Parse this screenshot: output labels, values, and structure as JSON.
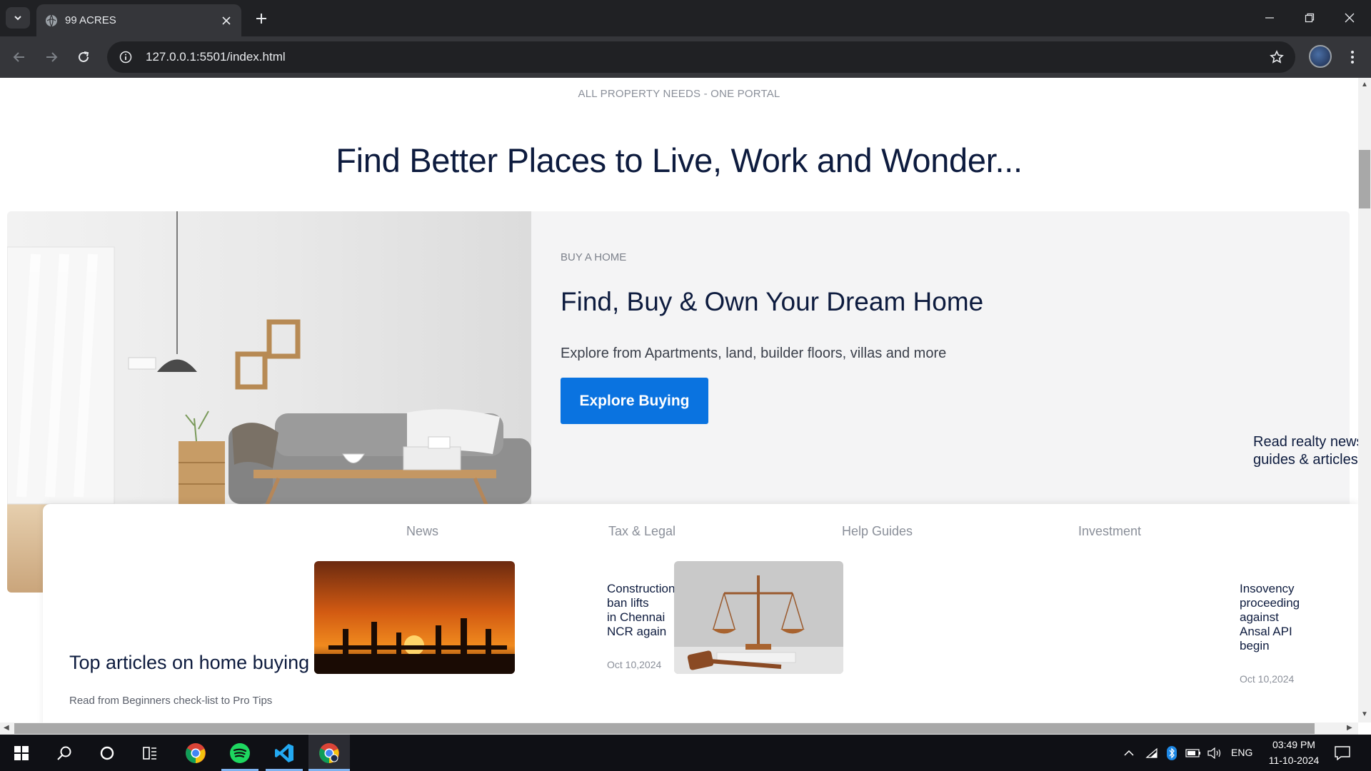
{
  "browser": {
    "tab_title": "99 ACRES",
    "url": "127.0.0.1:5501/index.html"
  },
  "page": {
    "eyebrow": "ALL PROPERTY NEEDS - ONE PORTAL",
    "headline": "Find Better Places to Live, Work and Wonder...",
    "buy": {
      "eyebrow": "BUY A HOME",
      "title": "Find, Buy & Own Your Dream Home",
      "description": "Explore from Apartments, land, builder floors, villas and more",
      "button_label": "Explore Buying"
    },
    "news_callout": {
      "line1": "Read realty news",
      "line2": "guides & articles"
    },
    "articles": {
      "tabs": [
        "News",
        "Tax & Legal",
        "Help Guides",
        "Investment"
      ],
      "title": "Top articles on home buying",
      "subtitle": "Read from Beginners check-list to Pro Tips",
      "items": [
        {
          "title_lines": [
            "Construction",
            "ban lifts",
            "in Chennai",
            "NCR again"
          ],
          "date": "Oct 10,2024"
        },
        {
          "title_lines": [
            "Insovency",
            "proceeding",
            "against",
            "Ansal API",
            "begin"
          ],
          "date": "Oct 10,2024"
        }
      ]
    }
  },
  "taskbar": {
    "language": "ENG",
    "time": "03:49 PM",
    "date": "11-10-2024"
  },
  "colors": {
    "primary_button": "#0a73e0",
    "headline": "#0d1b3e"
  }
}
